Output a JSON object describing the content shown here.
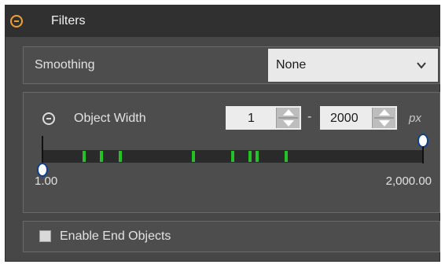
{
  "panel": {
    "title": "Filters",
    "collapse_icon": "minus-circle-icon",
    "accent": "#f0a030"
  },
  "smoothing": {
    "label": "Smoothing",
    "selected": "None",
    "dropdown_icon": "chevron-down-icon"
  },
  "object_width": {
    "label": "Object Width",
    "collapse_icon": "minus-circle-icon",
    "min_value": "1",
    "separator": "-",
    "max_value": "2000",
    "unit": "px",
    "range_min_label": "1.00",
    "range_max_label": "2,000.00",
    "slider_min_fraction": 0.0,
    "slider_max_fraction": 1.0,
    "marker_color": "#22c322",
    "marker_fractions": [
      0.105,
      0.151,
      0.201,
      0.392,
      0.496,
      0.541,
      0.559,
      0.636
    ]
  },
  "end_objects": {
    "label": "Enable End Objects",
    "checked": false
  }
}
